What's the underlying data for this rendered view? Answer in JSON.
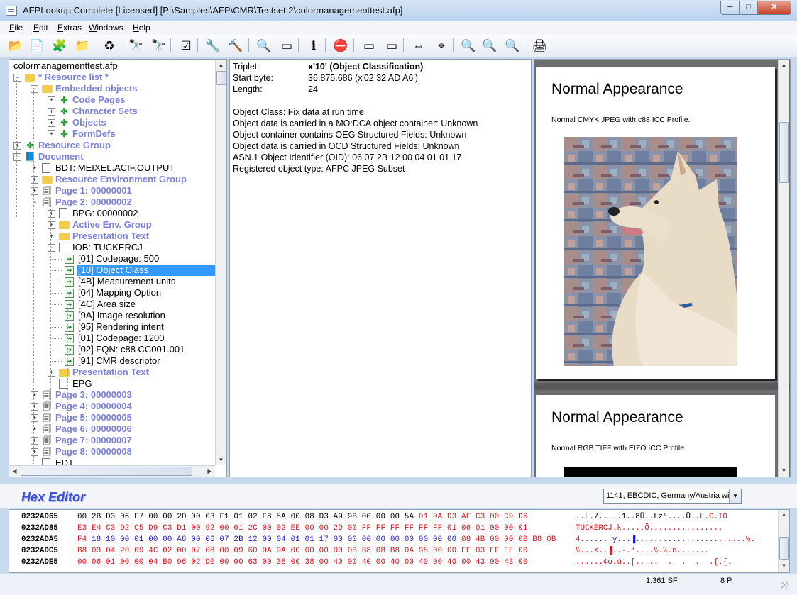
{
  "window": {
    "title": "AFPLookup Complete   [Licensed]   [P:\\Samples\\AFP\\CMR\\Testset 2\\colormanagementtest.afp]",
    "min": "─",
    "max": "□",
    "close": "✕"
  },
  "menu": [
    {
      "label": "File",
      "key": "F",
      "rest": "ile"
    },
    {
      "label": "Edit",
      "key": "E",
      "rest": "dit"
    },
    {
      "label": "Extras",
      "key": "E",
      "rest": "xtras"
    },
    {
      "label": "Windows",
      "key": "W",
      "rest": "indows"
    },
    {
      "label": "Help",
      "key": "H",
      "rest": "elp"
    }
  ],
  "toolbar": [
    {
      "name": "open-icon",
      "glyph": "📂"
    },
    {
      "name": "export-icon",
      "glyph": "📄"
    },
    {
      "name": "resources-icon",
      "glyph": "🧩"
    },
    {
      "name": "folder-icon",
      "glyph": "📁"
    },
    {
      "name": "refresh-icon",
      "glyph": "♻"
    },
    {
      "name": "find-icon",
      "glyph": "🔭"
    },
    {
      "name": "find-next-icon",
      "glyph": "🔭"
    },
    {
      "name": "checklist-icon",
      "glyph": "☑"
    },
    {
      "name": "tools-icon",
      "glyph": "🔧"
    },
    {
      "name": "settings-icon",
      "glyph": "🔨"
    },
    {
      "name": "view-icon",
      "glyph": "🔍"
    },
    {
      "name": "disabled-icon",
      "glyph": "▭"
    },
    {
      "name": "info-icon",
      "glyph": "ℹ"
    },
    {
      "name": "stop-icon",
      "glyph": "⛔"
    },
    {
      "name": "page-prev-icon",
      "glyph": "▭"
    },
    {
      "name": "page-next-icon",
      "glyph": "▭"
    },
    {
      "name": "fit-width-icon",
      "glyph": "⇔"
    },
    {
      "name": "fit-page-icon",
      "glyph": "⌖"
    },
    {
      "name": "zoom-out-icon",
      "glyph": "🔍"
    },
    {
      "name": "zoom-100-icon",
      "glyph": "🔍"
    },
    {
      "name": "zoom-in-icon",
      "glyph": "🔍"
    },
    {
      "name": "print-icon",
      "glyph": "🖨"
    }
  ],
  "tree": {
    "root": "colormanagementtest.afp",
    "items": [
      {
        "label": "* Resource list *",
        "level": 1,
        "exp": "−",
        "icon": "folder",
        "blue": true
      },
      {
        "label": "Embedded objects",
        "level": 2,
        "exp": "−",
        "icon": "folder",
        "blue": true
      },
      {
        "label": "Code Pages",
        "level": 3,
        "exp": "+",
        "icon": "puzzle",
        "blue": true
      },
      {
        "label": "Character Sets",
        "level": 3,
        "exp": "+",
        "icon": "puzzle",
        "blue": true
      },
      {
        "label": "Objects",
        "level": 3,
        "exp": "+",
        "icon": "puzzle",
        "blue": true
      },
      {
        "label": "FormDefs",
        "level": 3,
        "exp": "+",
        "icon": "puzzle",
        "blue": true
      },
      {
        "label": "Resource Group",
        "level": 1,
        "exp": "+",
        "icon": "puzzle",
        "blue": true
      },
      {
        "label": "Document",
        "level": 1,
        "exp": "−",
        "icon": "book",
        "blue": true
      },
      {
        "label": "BDT: MEIXEL.ACIF.OUTPUT",
        "level": 2,
        "exp": "+",
        "icon": "doc",
        "blue": false
      },
      {
        "label": "Resource Environment Group",
        "level": 2,
        "exp": "+",
        "icon": "folder",
        "blue": true
      },
      {
        "label": "Page 1: 00000001",
        "level": 2,
        "exp": "+",
        "icon": "pages",
        "blue": true
      },
      {
        "label": "Page 2: 00000002",
        "level": 2,
        "exp": "−",
        "icon": "pages",
        "blue": true
      },
      {
        "label": "BPG: 00000002",
        "level": 3,
        "exp": "+",
        "icon": "doc",
        "blue": false
      },
      {
        "label": "Active Env. Group",
        "level": 3,
        "exp": "+",
        "icon": "folder",
        "blue": true
      },
      {
        "label": "Presentation Text",
        "level": 3,
        "exp": "+",
        "icon": "folder",
        "blue": true
      },
      {
        "label": "IOB: TUCKERCJ",
        "level": 3,
        "exp": "−",
        "icon": "doc",
        "blue": false
      },
      {
        "label": "[01] Codepage: 500",
        "level": 4,
        "exp": "",
        "icon": "tri",
        "blue": false
      },
      {
        "label": "[10] Object Class",
        "level": 4,
        "exp": "",
        "icon": "tri",
        "blue": false,
        "selected": true
      },
      {
        "label": "[4B] Measurement units",
        "level": 4,
        "exp": "",
        "icon": "tri",
        "blue": false
      },
      {
        "label": "[04] Mapping Option",
        "level": 4,
        "exp": "",
        "icon": "tri",
        "blue": false
      },
      {
        "label": "[4C] Area size",
        "level": 4,
        "exp": "",
        "icon": "tri",
        "blue": false
      },
      {
        "label": "[9A] Image resolution",
        "level": 4,
        "exp": "",
        "icon": "tri",
        "blue": false
      },
      {
        "label": "[95] Rendering intent",
        "level": 4,
        "exp": "",
        "icon": "tri",
        "blue": false
      },
      {
        "label": "[01] Codepage: 1200",
        "level": 4,
        "exp": "",
        "icon": "tri",
        "blue": false
      },
      {
        "label": "[02] FQN: c88     CC001.001",
        "level": 4,
        "exp": "",
        "icon": "tri",
        "blue": false
      },
      {
        "label": "[91] CMR descriptor",
        "level": 4,
        "exp": "",
        "icon": "tri",
        "blue": false
      },
      {
        "label": "Presentation Text",
        "level": 3,
        "exp": "+",
        "icon": "folder",
        "blue": true
      },
      {
        "label": "EPG",
        "level": 3,
        "exp": "",
        "icon": "doc",
        "blue": false
      },
      {
        "label": "Page 3: 00000003",
        "level": 2,
        "exp": "+",
        "icon": "pages",
        "blue": true
      },
      {
        "label": "Page 4: 00000004",
        "level": 2,
        "exp": "+",
        "icon": "pages",
        "blue": true
      },
      {
        "label": "Page 5: 00000005",
        "level": 2,
        "exp": "+",
        "icon": "pages",
        "blue": true
      },
      {
        "label": "Page 6: 00000006",
        "level": 2,
        "exp": "+",
        "icon": "pages",
        "blue": true
      },
      {
        "label": "Page 7: 00000007",
        "level": 2,
        "exp": "+",
        "icon": "pages",
        "blue": true
      },
      {
        "label": "Page 8: 00000008",
        "level": 2,
        "exp": "+",
        "icon": "pages",
        "blue": true
      },
      {
        "label": "EDT",
        "level": 2,
        "exp": "",
        "icon": "doc",
        "blue": false
      }
    ]
  },
  "info": {
    "triplet_label": "Triplet:",
    "triplet_value": "x'10' (Object Classification)",
    "start_label": "Start byte:",
    "start_value": "36.875.686   (x'02 32 AD A6')",
    "length_label": "Length:",
    "length_value": "24",
    "lines": [
      "Object Class: Fix data at run time",
      "Object data is carried in a MO:DCA object container: Unknown",
      "Object container contains OEG Structured Fields: Unknown",
      "Object data is carried in OCD Structured Fields: Unknown",
      "ASN.1 Object Identifier (OID): 06 07 2B 12 00 04 01 01 17",
      "Registered object type: AFPC JPEG Subset"
    ]
  },
  "preview": {
    "pages": [
      {
        "title": "Normal Appearance",
        "subtitle": "Normal CMYK JPEG with c88 ICC Profile."
      },
      {
        "title": "Normal Appearance",
        "subtitle": "Normal RGB TIFF with EIZO ICC Profile."
      }
    ]
  },
  "hex": {
    "title": "Hex Editor",
    "encoding": "1141, EBCDIC, Germany/Austria wi",
    "rows": [
      {
        "addr": "0232AD65",
        "bytes": [
          [
            "00 2B D3 06 F7 00 00 2D 00 03 F1 01 02 F8 5A 00 08 D3 A9 9B 00 00 00 5A ",
            "#000"
          ],
          [
            "01 0A D3 AF C3 00 C9 D6",
            "#d8141a"
          ]
        ],
        "ascii": [
          [
            "..L.7.....1..8Ü..Lz°....Ü",
            "#000"
          ],
          [
            "..L.C.IO",
            "#d8141a"
          ]
        ]
      },
      {
        "addr": "0232AD85",
        "bytes": [
          [
            "E3 E4 C3 D2 C5 D9 C3 D1 00 92 00 01 2C 00 02 EE 00 00 2D 00 FF FF FF FF FF FF 01 06 01 00 00 01",
            "#d8141a"
          ]
        ],
        "ascii": [
          [
            "TUCKERCJ.k.....Ö................",
            "#d8141a"
          ]
        ]
      },
      {
        "addr": "0232ADA5",
        "bytes": [
          [
            "F4 ",
            "#d8141a"
          ],
          [
            "18 10 00 01 00 00 A8 00 06 07 2B 12 00 04 01 01 17 00 00 00 00 00 00 00 00 00 ",
            "#1818d8"
          ],
          [
            "08 4B 00 00 0B B8 0B",
            "#d8141a"
          ]
        ],
        "ascii": [
          [
            "4",
            "#d8141a"
          ],
          [
            ".......y...▐..................",
            "#1818d8"
          ],
          [
            "......½.",
            "#d8141a"
          ]
        ]
      },
      {
        "addr": "0232ADC5",
        "bytes": [
          [
            "B8 03 04 20 09 4C 02 00 07 08 00 09 60 0A 9A 00 00 00 00 0B B8 0B B8 0A 95 00 00 FF 03 FF FF 00",
            "#d8141a"
          ]
        ],
        "ascii": [
          [
            "½...<..▐..-.ª....½.½.n.......",
            "#d8141a"
          ]
        ]
      },
      {
        "addr": "0232ADE5",
        "bytes": [
          [
            "00 06 01 00 00 04 B0 96 02 DE 00 00 63 00 38 00 38 00 40 00 40 00 40 00 40 00 40 00 43 00 43 00",
            "#d8141a"
          ]
        ],
        "ascii": [
          [
            "......¢o.ú..[.....  .  .  .  .{.{.",
            "#d8141a"
          ]
        ]
      }
    ]
  },
  "status": {
    "left": "1.361 SF",
    "right": "8 P."
  }
}
